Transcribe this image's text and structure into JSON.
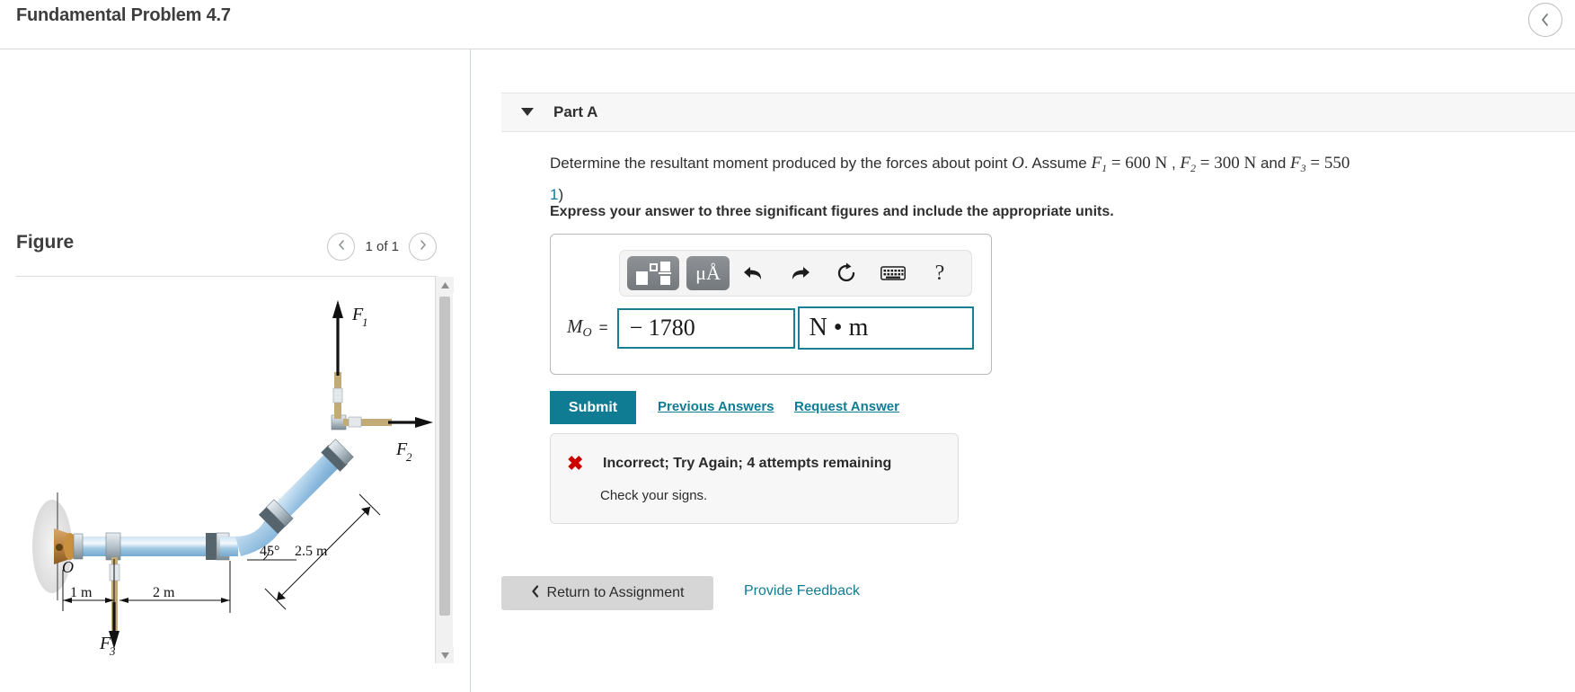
{
  "header": {
    "title": "Fundamental Problem 4.7",
    "collapse_icon": "chevron-left-icon"
  },
  "figure": {
    "title": "Figure",
    "prev_icon": "chevron-left-icon",
    "next_icon": "chevron-right-icon",
    "counter": "1 of 1",
    "labels": {
      "f1": "F",
      "f1_sub": "1",
      "f2": "F",
      "f2_sub": "2",
      "f3": "F",
      "f3_sub": "3",
      "origin": "O",
      "angle": "45°",
      "len_diag": "2.5 m",
      "len_1": "1 m",
      "len_2": "2 m"
    },
    "scroll_up_icon": "triangle-up-icon",
    "scroll_down_icon": "triangle-down-icon"
  },
  "part": {
    "caret_icon": "caret-down-icon",
    "label": "Part A",
    "question_pre": "Determine the resultant moment produced by the forces about point ",
    "question_point": "O",
    "question_mid": ". Assume ",
    "f1_name": "F",
    "f1_sub": "1",
    "f1_eq": " = 600 N",
    "sep1": " , ",
    "f2_name": "F",
    "f2_sub": "2",
    "f2_eq": " = 300 N",
    "sep2": " and ",
    "f3_name": "F",
    "f3_sub": "3",
    "f3_eq": " = 550",
    "line2_num": "1",
    "line2_rest": ")",
    "instruction": "Express your answer to three significant figures and include the appropriate units."
  },
  "answer": {
    "toolbar": {
      "template_icon": "math-template-icon",
      "units_icon": "units-mu-angstrom-icon",
      "units_label": "μÅ",
      "undo_icon": "undo-arrow-icon",
      "redo_icon": "redo-arrow-icon",
      "reset_icon": "reset-circular-arrow-icon",
      "keyboard_icon": "keyboard-icon",
      "help_icon": "question-mark-icon",
      "help_label": "?"
    },
    "label": "M",
    "label_sub": "O",
    "equals": "=",
    "value": "− 1780",
    "unit": "N • m"
  },
  "actions": {
    "submit_label": "Submit",
    "previous_answers_label": "Previous Answers",
    "request_answer_label": "Request Answer"
  },
  "feedback": {
    "status_icon": "red-x-icon",
    "status_mark": "✖",
    "title": "Incorrect; Try Again; 4 attempts remaining",
    "detail": "Check your signs."
  },
  "footer": {
    "return_icon": "chevron-left-icon",
    "return_label": "Return to Assignment",
    "feedback_label": "Provide Feedback"
  },
  "colors": {
    "accent": "#0f7c93",
    "error": "#cc0000",
    "field_border": "#1a7f93",
    "button_gray": "#d6d6d6"
  }
}
